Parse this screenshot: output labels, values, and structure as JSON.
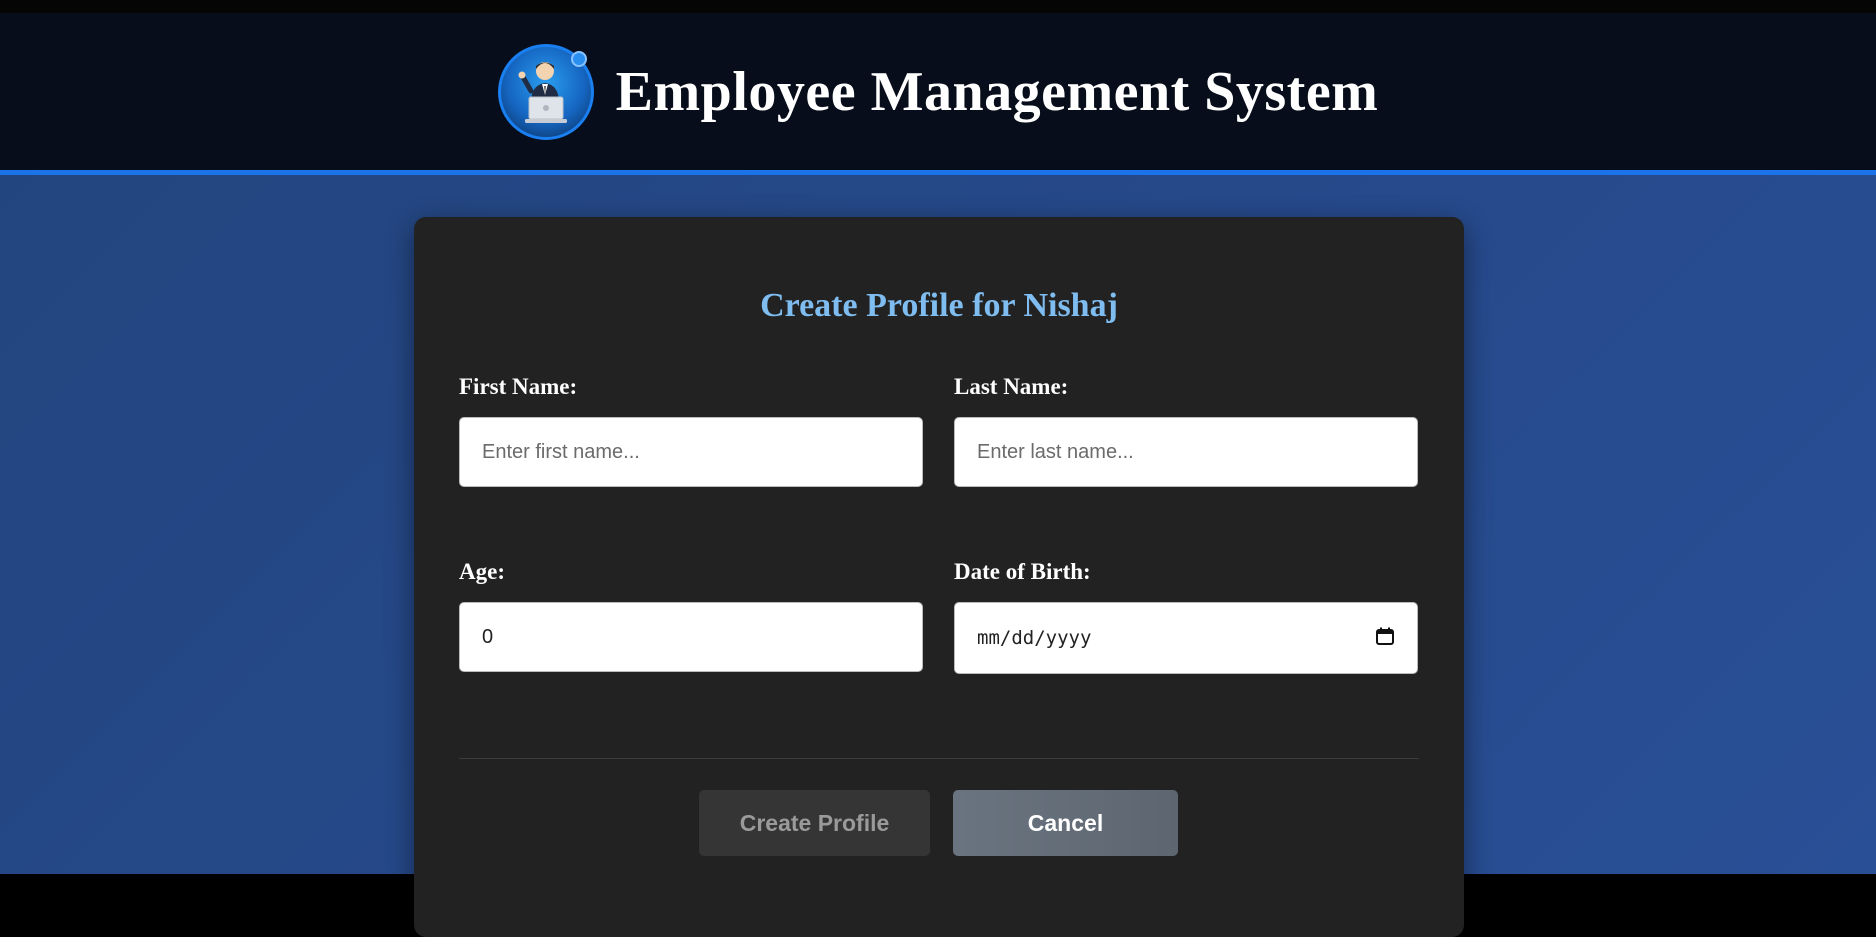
{
  "header": {
    "title": "Employee Management System",
    "logo_icon": "employee-avatar-icon"
  },
  "form": {
    "title": "Create Profile for Nishaj",
    "first_name": {
      "label": "First Name:",
      "placeholder": "Enter first name...",
      "value": ""
    },
    "last_name": {
      "label": "Last Name:",
      "placeholder": "Enter last name...",
      "value": ""
    },
    "age": {
      "label": "Age:",
      "value": "0"
    },
    "dob": {
      "label": "Date of Birth:",
      "placeholder": "mm/dd/yyyy",
      "icon": "calendar-icon"
    },
    "create_button": "Create Profile",
    "cancel_button": "Cancel"
  },
  "colors": {
    "accent": "#1a73e8",
    "header_bg": "#070d1a",
    "page_bg": "#26498a",
    "card_bg": "#222222",
    "title_color": "#7fbcf0",
    "create_disabled_bg": "#353535",
    "cancel_bg": "#646d78"
  }
}
